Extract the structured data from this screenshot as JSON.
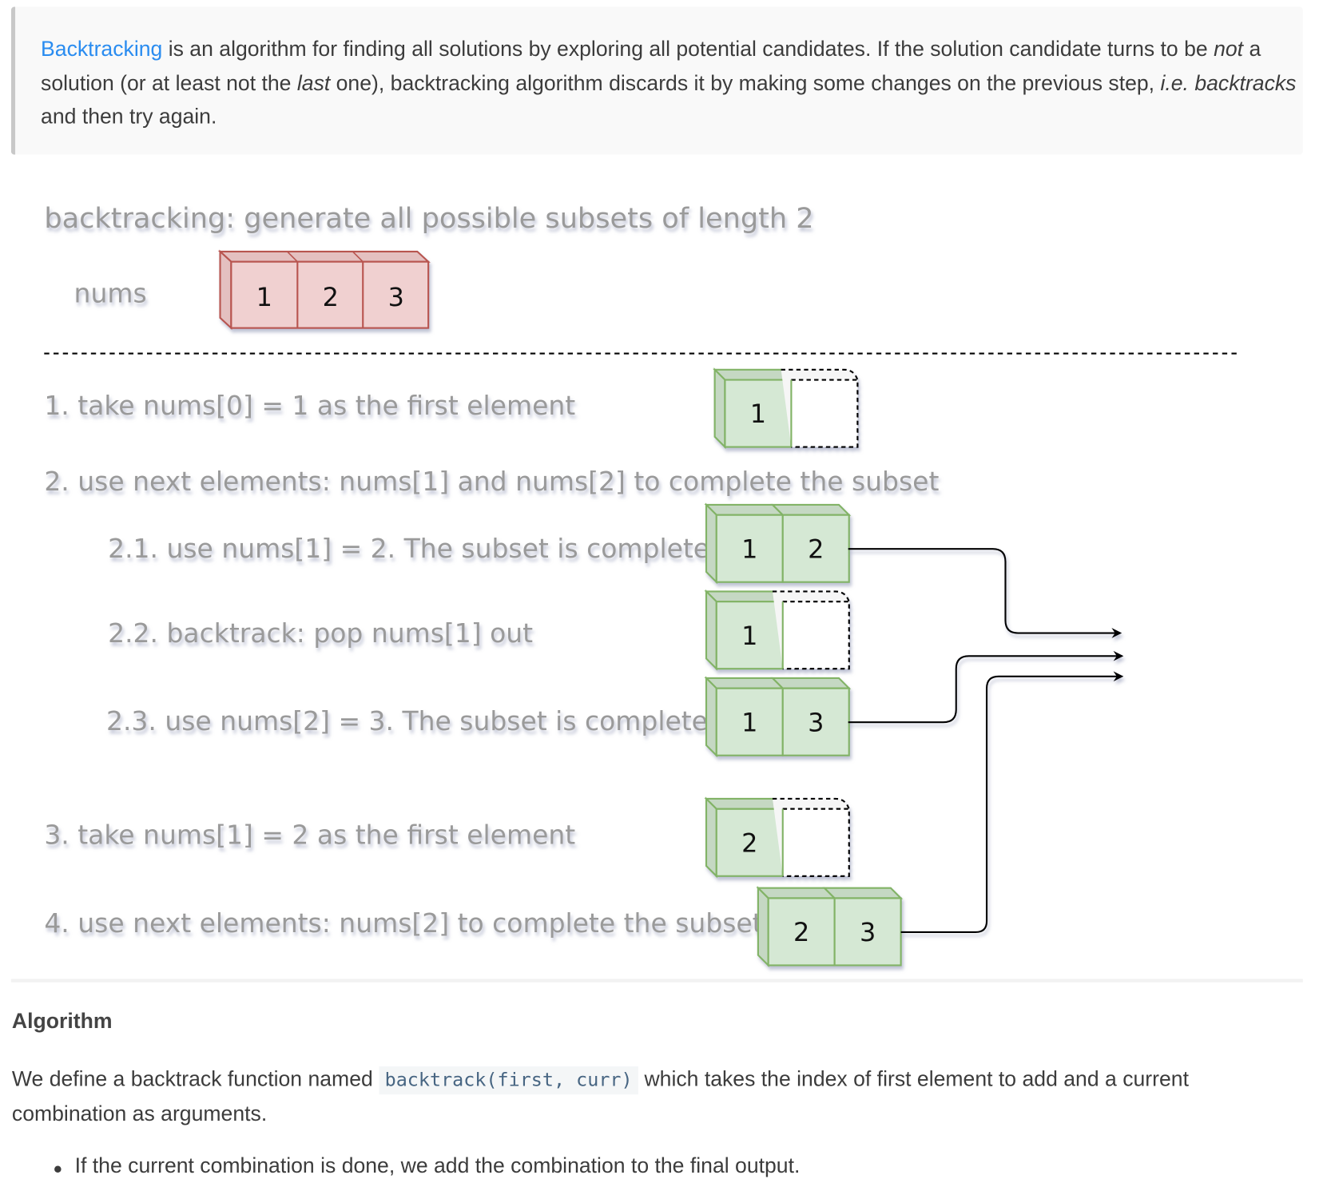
{
  "intro": {
    "link_text": "Backtracking",
    "text_1": " is an algorithm for finding all solutions by exploring all potential candidates. If the solution candidate turns to be ",
    "em_1": "not",
    "text_2": " a solution (or at least not the ",
    "em_2": "last",
    "text_3": " one), backtracking algorithm discards it by making some changes on the previous step, ",
    "em_3": "i.e.",
    "text_4": " ",
    "em_4": "backtracks",
    "text_5": " and then try again."
  },
  "diagram": {
    "title": "backtracking: generate all possible subsets of length 2",
    "nums_label": "nums",
    "nums": [
      "1",
      "2",
      "3"
    ],
    "steps": [
      "1. take nums[0] = 1 as the first element",
      "2. use next elements: nums[1] and nums[2] to complete the subset",
      "2.1. use nums[1] = 2. The subset is complete",
      "2.2. backtrack: pop nums[1] out",
      "2.3. use nums[2] = 3. The subset is complete",
      "3. take nums[1] = 2 as the first element",
      "4. use next elements: nums[2] to complete the subset"
    ],
    "boxes": {
      "step1": [
        "1",
        ""
      ],
      "step2_1": [
        "1",
        "2"
      ],
      "step2_2": [
        "1",
        ""
      ],
      "step2_3": [
        "1",
        "3"
      ],
      "step3": [
        "2",
        ""
      ],
      "step4": [
        "2",
        "3"
      ]
    },
    "colors": {
      "nums_fill": "#f0d0d0",
      "nums_stroke": "#b85450",
      "subset_fill": "#d5e8d4",
      "subset_stroke": "#82b366"
    }
  },
  "algorithm": {
    "heading": "Algorithm",
    "para_1": "We define a backtrack function named ",
    "code": "backtrack(first, curr)",
    "para_2": " which takes the index of first element to add and a current combination as arguments.",
    "bullets": [
      "If the current combination is done, we add the combination to the final output."
    ]
  }
}
